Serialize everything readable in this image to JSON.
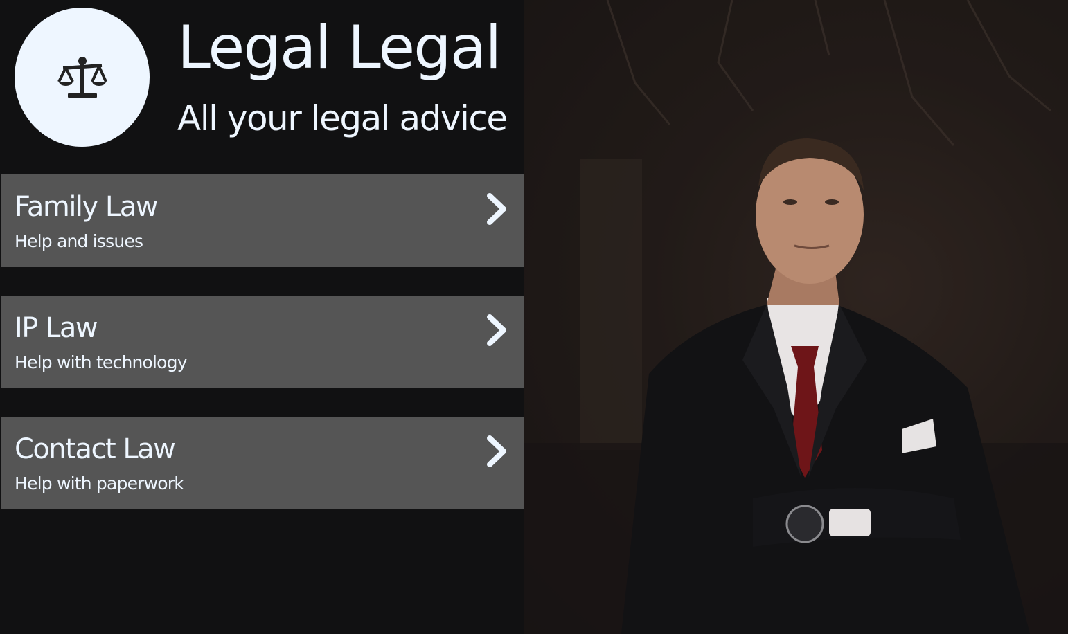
{
  "header": {
    "title": "Legal Legal",
    "tagline": "All your legal advice",
    "logo_icon": "scales-of-justice-icon"
  },
  "menu": [
    {
      "label": "Family Law",
      "sub": "Help and issues",
      "icon": "chevron-right-icon"
    },
    {
      "label": "IP Law",
      "sub": "Help with technology",
      "icon": "chevron-right-icon"
    },
    {
      "label": "Contact Law",
      "sub": "Help with paperwork",
      "icon": "chevron-right-icon"
    }
  ],
  "hero_image": {
    "subject": "man-in-suit-photo"
  },
  "colors": {
    "background": "#111112",
    "menu_item": "#555555",
    "text": "#eef6ff",
    "logo_circle": "#eef6ff"
  }
}
